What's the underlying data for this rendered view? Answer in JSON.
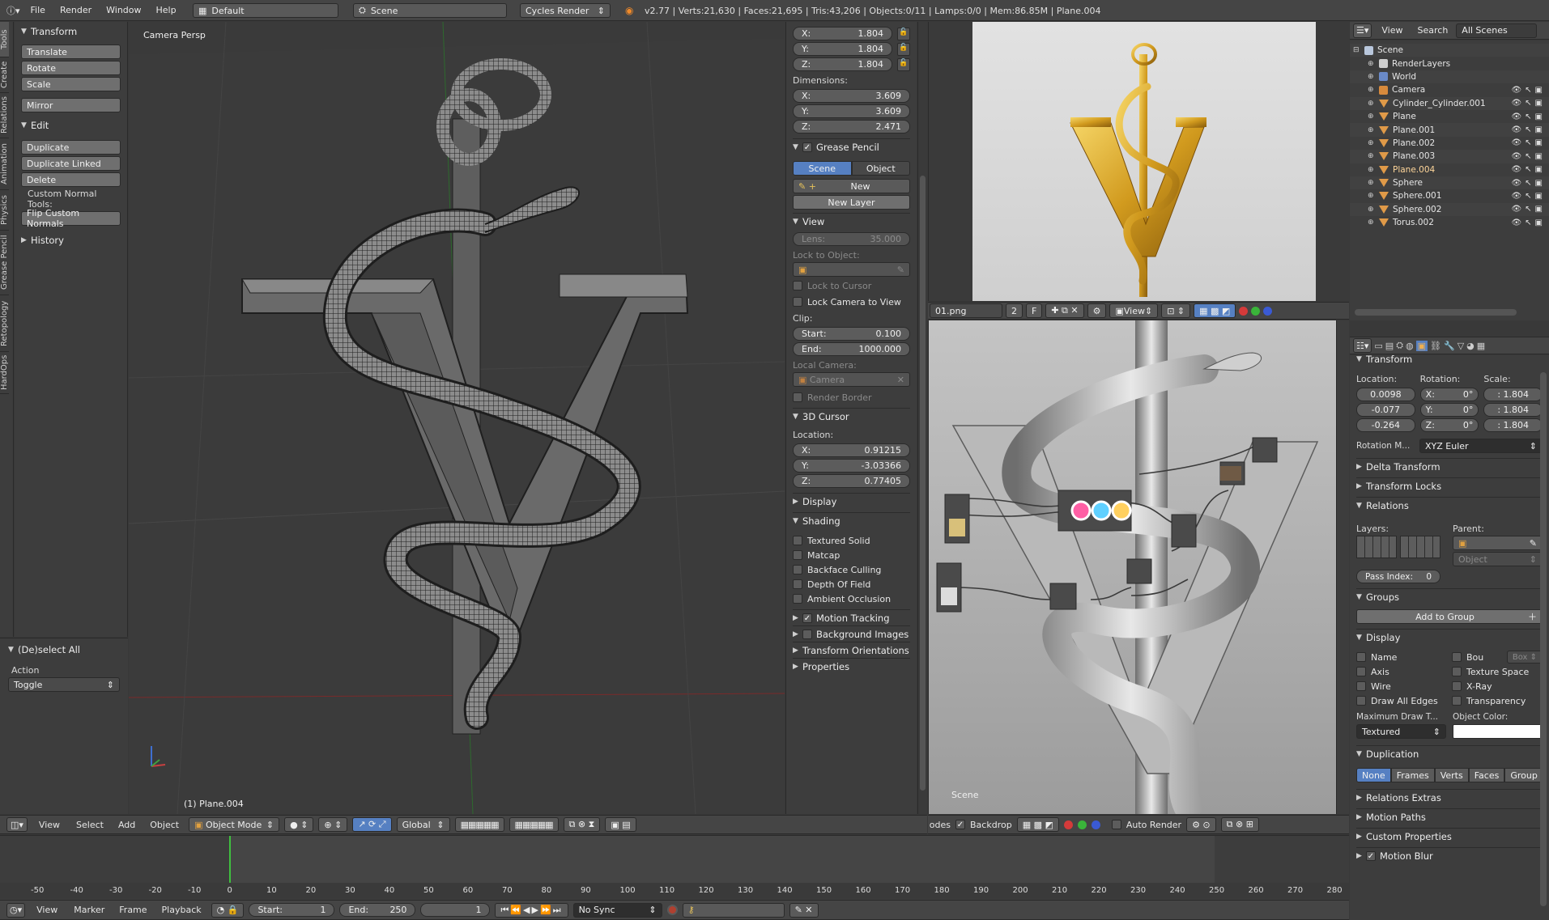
{
  "topbar": {
    "menus": [
      "File",
      "Render",
      "Window",
      "Help"
    ],
    "layout": "Default",
    "scene": "Scene",
    "engine": "Cycles Render",
    "stats": "v2.77 | Verts:21,630 | Faces:21,695 | Tris:43,206 | Objects:0/11 | Lamps:0/0 | Mem:86.85M | Plane.004"
  },
  "vtabs": [
    "Tools",
    "Create",
    "Relations",
    "Animation",
    "Physics",
    "Grease Pencil",
    "Retopology",
    "HardOps"
  ],
  "toolshelf": {
    "transform_title": "Transform",
    "transform_buttons": [
      "Translate",
      "Rotate",
      "Scale"
    ],
    "mirror": "Mirror",
    "edit_title": "Edit",
    "edit_buttons": [
      "Duplicate",
      "Duplicate Linked",
      "Delete"
    ],
    "custom_normal_label": "Custom Normal Tools:",
    "flip_button": "Flip Custom Normals",
    "history_title": "History",
    "operator_title": "(De)select All",
    "action_label": "Action",
    "action_value": "Toggle"
  },
  "viewport": {
    "label": "Camera Persp",
    "object_label": "(1) Plane.004",
    "header": {
      "menus": [
        "View",
        "Select",
        "Add",
        "Object"
      ],
      "mode": "Object Mode",
      "orientation": "Global"
    }
  },
  "npanel": {
    "scale": [
      {
        "axis": "X:",
        "value": "1.804"
      },
      {
        "axis": "Y:",
        "value": "1.804"
      },
      {
        "axis": "Z:",
        "value": "1.804"
      }
    ],
    "dimensions_label": "Dimensions:",
    "dimensions": [
      {
        "axis": "X:",
        "value": "3.609"
      },
      {
        "axis": "Y:",
        "value": "3.609"
      },
      {
        "axis": "Z:",
        "value": "2.471"
      }
    ],
    "grease_pencil": "Grease Pencil",
    "gp_tabs": [
      "Scene",
      "Object"
    ],
    "gp_new": "New",
    "gp_new_layer": "New Layer",
    "view_title": "View",
    "lens_label": "Lens:",
    "lens_value": "35.000",
    "lock_to_object": "Lock to Object:",
    "lock_to_cursor": "Lock to Cursor",
    "lock_camera": "Lock Camera to View",
    "clip_label": "Clip:",
    "clip_start_label": "Start:",
    "clip_start": "0.100",
    "clip_end_label": "End:",
    "clip_end": "1000.000",
    "local_camera": "Local Camera:",
    "camera_field": "Camera",
    "render_border": "Render Border",
    "cursor_title": "3D Cursor",
    "location_label": "Location:",
    "cursor": [
      {
        "axis": "X:",
        "value": "0.91215"
      },
      {
        "axis": "Y:",
        "value": "-3.03366"
      },
      {
        "axis": "Z:",
        "value": "0.77405"
      }
    ],
    "display_title": "Display",
    "shading_title": "Shading",
    "shading_items": [
      "Textured Solid",
      "Matcap",
      "Backface Culling",
      "Depth Of Field",
      "Ambient Occlusion"
    ],
    "collapsed": [
      "Motion Tracking",
      "Background Images",
      "Transform Orientations",
      "Properties"
    ]
  },
  "image_editor": {
    "filename": "01.png",
    "slot": "2",
    "flag": "F",
    "view_menu": "View"
  },
  "node_editor": {
    "scene_label": "Scene",
    "header": {
      "menu_partial": "Nodes",
      "backdrop": "Backdrop",
      "auto_render": "Auto Render"
    }
  },
  "outliner": {
    "menus": [
      "View",
      "Search"
    ],
    "filter": "All Scenes",
    "items": [
      {
        "name": "Scene",
        "kind": "scene",
        "indent": 0
      },
      {
        "name": "RenderLayers",
        "kind": "layers",
        "indent": 1
      },
      {
        "name": "World",
        "kind": "world",
        "indent": 1
      },
      {
        "name": "Camera",
        "kind": "camera",
        "indent": 1
      },
      {
        "name": "Cylinder_Cylinder.001",
        "kind": "mesh",
        "indent": 1
      },
      {
        "name": "Plane",
        "kind": "mesh",
        "indent": 1
      },
      {
        "name": "Plane.001",
        "kind": "mesh",
        "indent": 1
      },
      {
        "name": "Plane.002",
        "kind": "mesh",
        "indent": 1
      },
      {
        "name": "Plane.003",
        "kind": "mesh",
        "indent": 1
      },
      {
        "name": "Plane.004",
        "kind": "mesh",
        "indent": 1,
        "selected": true
      },
      {
        "name": "Sphere",
        "kind": "mesh",
        "indent": 1
      },
      {
        "name": "Sphere.001",
        "kind": "mesh",
        "indent": 1
      },
      {
        "name": "Sphere.002",
        "kind": "mesh",
        "indent": 1
      },
      {
        "name": "Torus.002",
        "kind": "mesh",
        "indent": 1
      }
    ]
  },
  "properties": {
    "transform_title": "Transform",
    "location_label": "Location:",
    "rotation_label": "Rotation:",
    "scale_label": "Scale:",
    "location": [
      "0.0098",
      "-0.077",
      "-0.264"
    ],
    "rotation": [
      {
        "axis": "X:",
        "value": "0°"
      },
      {
        "axis": "Y:",
        "value": "0°"
      },
      {
        "axis": "Z:",
        "value": "0°"
      }
    ],
    "scale": [
      ": 1.804",
      ": 1.804",
      ": 1.804"
    ],
    "rotation_mode_label": "Rotation M...",
    "rotation_mode": "XYZ Euler",
    "delta": "Delta Transform",
    "locks": "Transform Locks",
    "relations": "Relations",
    "layers_label": "Layers:",
    "parent_label": "Parent:",
    "parent_type": "Object",
    "pass_index_label": "Pass Index:",
    "pass_index": "0",
    "groups": "Groups",
    "add_to_group": "Add to Group",
    "display": "Display",
    "display_left": [
      "Name",
      "Axis",
      "Wire",
      "Draw All Edges"
    ],
    "display_right": [
      "Bou",
      "Texture Space",
      "X-Ray",
      "Transparency"
    ],
    "bounds_type": "Box",
    "max_draw_label": "Maximum Draw T...",
    "max_draw": "Textured",
    "object_color_label": "Object Color:",
    "duplication": "Duplication",
    "dup_tabs": [
      "None",
      "Frames",
      "Verts",
      "Faces",
      "Group"
    ],
    "collapsed": [
      "Relations Extras",
      "Motion Paths",
      "Custom Properties",
      "Motion Blur"
    ]
  },
  "timeline": {
    "ticks": [
      "-50",
      "-40",
      "-30",
      "-20",
      "-10",
      "0",
      "10",
      "20",
      "30",
      "40",
      "50",
      "60",
      "70",
      "80",
      "90",
      "100",
      "110",
      "120",
      "130",
      "140",
      "150",
      "160",
      "170",
      "180",
      "190",
      "200",
      "210",
      "220",
      "230",
      "240",
      "250",
      "260",
      "270",
      "280"
    ],
    "menus": [
      "View",
      "Marker",
      "Frame",
      "Playback"
    ],
    "start_label": "Start:",
    "start": "1",
    "end_label": "End:",
    "end": "250",
    "current": "1",
    "sync": "No Sync"
  },
  "colors": {
    "accent": "#5680c2",
    "selected_text": "#ffd69a",
    "gold": "#d6a52a"
  }
}
